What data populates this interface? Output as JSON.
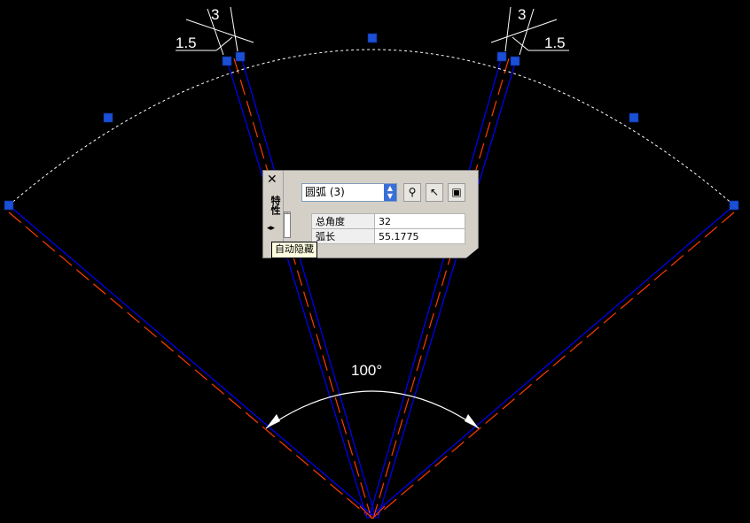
{
  "drawing": {
    "angle_label": "100°",
    "dim_left_top": "3",
    "dim_left_side": "1.5",
    "dim_right_top": "3",
    "dim_right_side": "1.5"
  },
  "palette": {
    "title": "特性",
    "close_glyph": "✕",
    "object_select": "圆弧 (3)",
    "buttons": [
      "quick-select",
      "select-objects",
      "toggle-pickadd"
    ],
    "properties": [
      {
        "key": "总角度",
        "value": "32"
      },
      {
        "key": "弧长",
        "value": "55.1775"
      }
    ],
    "tooltip": "自动隐藏"
  },
  "colors": {
    "blue_line": "#0000ff",
    "red_line": "#ff3b00",
    "grip": "#1a4fd6",
    "arc": "#ffffff"
  }
}
